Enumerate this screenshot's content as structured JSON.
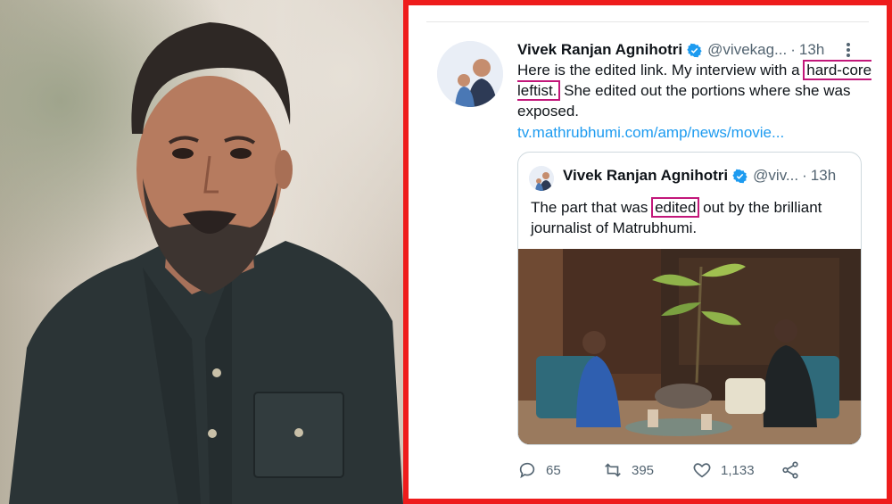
{
  "tweet": {
    "author_name": "Vivek Ranjan Agnihotri",
    "handle": "@vivekag...",
    "time": "13h",
    "dot": "·",
    "text_before": "Here is the edited link. My interview with a",
    "text_highlight": "hard-core leftist.",
    "text_after": "She edited out the portions where she was exposed.",
    "link": "tv.mathrubhumi.com/amp/news/movie..."
  },
  "quote": {
    "author_name": "Vivek Ranjan Agnihotri",
    "handle": "@viv...",
    "time": "13h",
    "dot": "·",
    "text_before": "The part that was",
    "text_highlight": "edited",
    "text_after": "out by the brilliant journalist of Matrubhumi."
  },
  "actions": {
    "replies": "65",
    "retweets": "395",
    "likes": "1,133"
  },
  "icons": [
    "verified-icon",
    "more-icon",
    "reply-icon",
    "retweet-icon",
    "like-icon",
    "share-icon"
  ],
  "colors": {
    "border": "#ee1c1c",
    "link": "#1d9bf0",
    "highlight": "#c2177a",
    "secondary": "#536471"
  }
}
